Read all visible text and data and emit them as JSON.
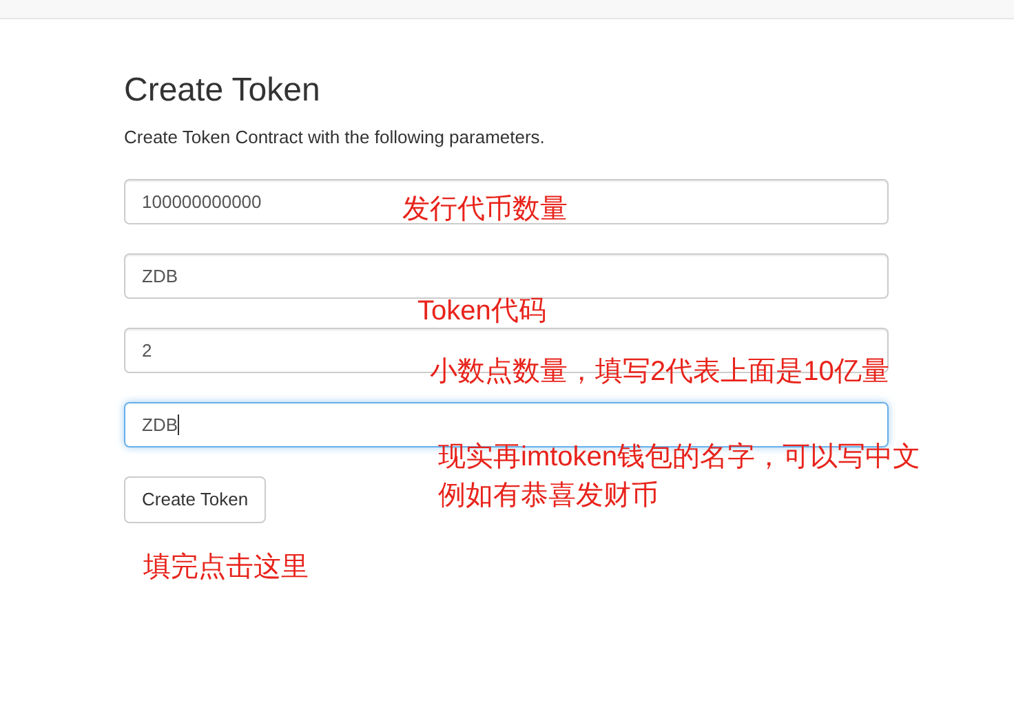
{
  "title": "Create Token",
  "subtitle": "Create Token Contract with the following parameters.",
  "fields": [
    {
      "value": "100000000000",
      "focused": false
    },
    {
      "value": "ZDB",
      "focused": false
    },
    {
      "value": "2",
      "focused": false
    },
    {
      "value": "ZDB",
      "focused": true
    }
  ],
  "button": "Create Token",
  "annotations": [
    {
      "lines": [
        "发行代币数量"
      ]
    },
    {
      "lines": [
        "Token代码"
      ]
    },
    {
      "lines": [
        "小数点数量，填写2代表上面是10亿量"
      ]
    },
    {
      "lines": [
        "现实再imtoken钱包的名字，可以写中文",
        "例如有恭喜发财币"
      ]
    },
    {
      "lines": [
        "填完点击这里"
      ]
    }
  ]
}
